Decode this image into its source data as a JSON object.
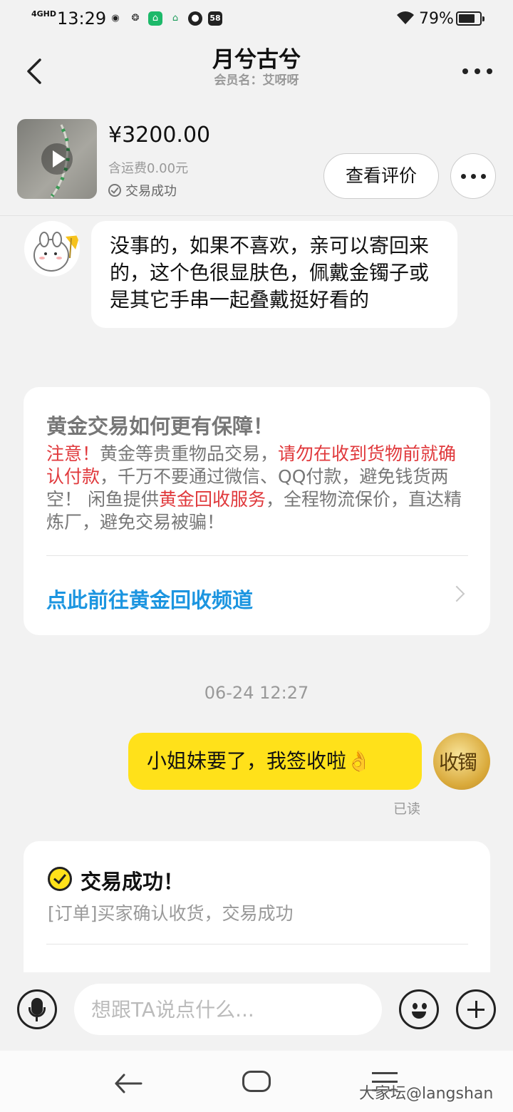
{
  "status_bar": {
    "network": "4GHD",
    "time": "13:29",
    "app_icons": [
      "weibo-icon",
      "swirl-icon",
      "wechat-work-icon",
      "home-app-icon",
      "fire-icon",
      "58-icon"
    ],
    "app_58_label": "58",
    "battery_percent": "79%",
    "battery_level": 0.79
  },
  "header": {
    "title": "月兮古兮",
    "subtitle": "会员名：艾呀呀"
  },
  "product": {
    "price": "¥3200.00",
    "shipping": "含运费0.00元",
    "status": "交易成功",
    "review_button": "查看评价"
  },
  "seller_message": {
    "text": "没事的，如果不喜欢，亲可以寄回来的，这个色很显肤色，佩戴金镯子或是其它手串一起叠戴挺好看的"
  },
  "gold_card": {
    "title": "黄金交易如何更有保障！",
    "notice_label": "注意！",
    "text_1": "黄金等贵重物品交易，",
    "warning_1": "请勿在收到货物前就确认付款",
    "text_2": "，千万不要通过微信、QQ付款，避免钱货两空！ 闲鱼提供",
    "warning_2": "黄金回收服务",
    "text_3": "，全程物流保价，直达精炼厂，避免交易被骗！",
    "link": "点此前往黄金回收频道"
  },
  "timestamp": "06-24 12:27",
  "my_message": {
    "text": "小姐妹要了，我签收啦👌",
    "read_status": "已读"
  },
  "success_card": {
    "title": "交易成功！",
    "body": "[订单]买家确认收货，交易成功"
  },
  "input_bar": {
    "placeholder": "想跟TA说点什么..."
  },
  "watermark": "大家坛@langshan",
  "colors": {
    "accent_yellow": "#ffe11a",
    "warning_red": "#e0393c",
    "link_blue": "#1c95e0",
    "background": "#f2f2f2"
  }
}
